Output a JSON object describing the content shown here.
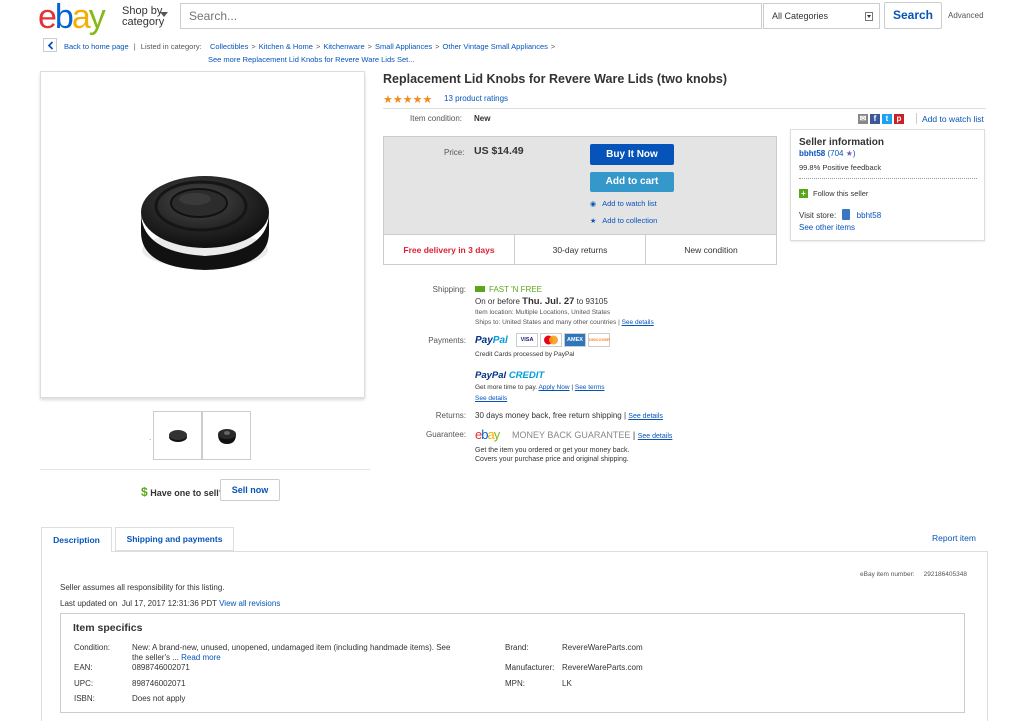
{
  "header": {
    "logo": [
      "e",
      "b",
      "a",
      "y"
    ],
    "shop_by_line1": "Shop by",
    "shop_by_line2": "category",
    "search_placeholder": "Search...",
    "category": "All Categories",
    "search_label": "Search",
    "advanced_label": "Advanced"
  },
  "breadcrumb": {
    "back_label": "Back to home page",
    "listed_in": "Listed in category:",
    "items": [
      "Collectibles",
      "Kitchen & Home",
      "Kitchenware",
      "Small Appliances",
      "Other Vintage Small Appliances"
    ],
    "see_more": "See more Replacement Lid Knobs for Revere Ware Lids Set..."
  },
  "left": {
    "thumb_dot": ".",
    "have_one": "Have one to sell?",
    "dollar": "$",
    "sell_now": "Sell now"
  },
  "item": {
    "title": "Replacement Lid Knobs for Revere Ware Lids (two knobs)",
    "stars": "★★★★★",
    "ratings": "13 product ratings",
    "condition_label": "Item condition:",
    "condition_value": "New",
    "add_watch_top": "Add to watch list",
    "share_icons": [
      "mail-icon",
      "facebook-icon",
      "twitter-icon",
      "pinterest-icon"
    ]
  },
  "buy": {
    "price_label": "Price:",
    "price": "US $14.49",
    "buy_now": "Buy It Now",
    "add_cart": "Add to cart",
    "add_watch": "Add to watch list",
    "add_collection": "Add to collection",
    "strip": [
      "Free delivery in 3 days",
      "30-day returns",
      "New condition"
    ]
  },
  "seller": {
    "title": "Seller information",
    "name": "bbht58",
    "score": "(704",
    "star": "★",
    "score_close": ")",
    "feedback": "99.8% Positive feedback",
    "follow": "Follow this seller",
    "visit_label": "Visit store:",
    "store": "bbht58",
    "see_other": "See other items"
  },
  "shipping": {
    "label": "Shipping:",
    "fast_free": "FAST 'N FREE",
    "on_or_before": "On or before",
    "date": "Thu. Jul. 27",
    "to": "to 93105",
    "location": "Item location:  Multiple Locations, United States",
    "ships_to": "Ships to:  United States and many other countries",
    "see_details": "See details"
  },
  "payments": {
    "label": "Payments:",
    "paypal_a": "Pay",
    "paypal_b": "Pal",
    "cards": [
      "VISA",
      "MC",
      "AMEX",
      "DISCOVER"
    ],
    "cc_processed": "Credit Cards processed by PayPal",
    "credit_a": "PayPal",
    "credit_b": "CREDIT",
    "more_time": "Get more time to pay.",
    "apply_now": "Apply Now",
    "see_terms": "See terms",
    "see_details": "See details"
  },
  "returns": {
    "label": "Returns:",
    "text": "30 days money back, free return shipping",
    "see_details": "See details"
  },
  "guarantee": {
    "label": "Guarantee:",
    "text": "MONEY BACK GUARANTEE",
    "see_details": "See details",
    "desc1": "Get the item you ordered or get your money back.",
    "desc2": "Covers your purchase price and original shipping."
  },
  "tabs": {
    "description": "Description",
    "shipping": "Shipping and payments",
    "report": "Report item"
  },
  "description": {
    "item_number_label": "eBay item number:",
    "item_number": "292186405348",
    "seller_assumes": "Seller assumes all responsibility for this listing.",
    "last_updated_label": "Last updated on",
    "last_updated": "Jul 17, 2017 12:31:36 PDT",
    "view_revisions": "View all revisions",
    "specifics_title": "Item specifics",
    "condition_label": "Condition:",
    "condition_text1": "New: A brand-new, unused, unopened, undamaged item (including handmade items). See",
    "condition_text2": "the seller's ...",
    "read_more": "Read more",
    "ean_label": "EAN:",
    "ean": "0898746002071",
    "upc_label": "UPC:",
    "upc": "898746002071",
    "isbn_label": "ISBN:",
    "isbn": "Does not apply",
    "brand_label": "Brand:",
    "brand": "RevereWareParts.com",
    "manufacturer_label": "Manufacturer:",
    "manufacturer": "RevereWareParts.com",
    "mpn_label": "MPN:",
    "mpn": "LK"
  }
}
